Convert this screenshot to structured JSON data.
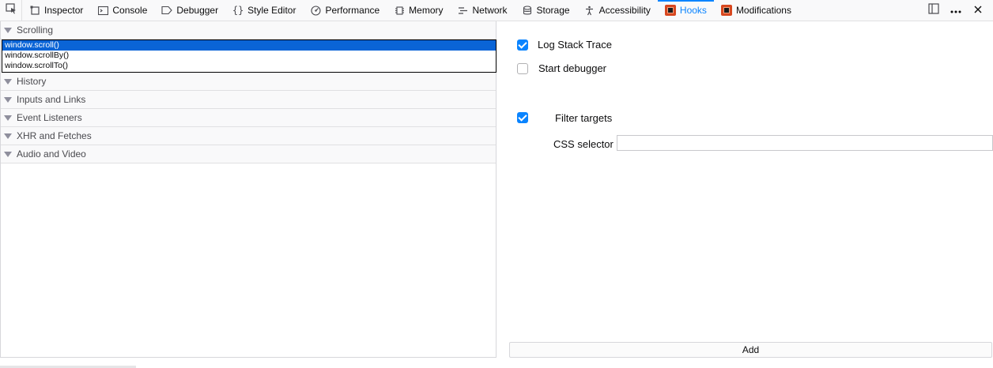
{
  "toolbar": {
    "tabs": [
      {
        "label": "Inspector",
        "icon": "inspector-icon"
      },
      {
        "label": "Console",
        "icon": "console-icon"
      },
      {
        "label": "Debugger",
        "icon": "debugger-icon"
      },
      {
        "label": "Style Editor",
        "icon": "braces-icon"
      },
      {
        "label": "Performance",
        "icon": "performance-icon"
      },
      {
        "label": "Memory",
        "icon": "memory-icon"
      },
      {
        "label": "Network",
        "icon": "network-icon"
      },
      {
        "label": "Storage",
        "icon": "storage-icon"
      },
      {
        "label": "Accessibility",
        "icon": "accessibility-icon"
      },
      {
        "label": "Hooks",
        "icon": "hooks-extension-icon",
        "selected": true
      },
      {
        "label": "Modifications",
        "icon": "modifications-extension-icon"
      }
    ],
    "accent": "#0a84ff"
  },
  "sections": [
    {
      "title": "Scrolling",
      "options": [
        "window.scroll()",
        "window.scrollBy()",
        "window.scrollTo()"
      ],
      "selected": "window.scroll()"
    },
    {
      "title": "History"
    },
    {
      "title": "Inputs and Links"
    },
    {
      "title": "Event Listeners"
    },
    {
      "title": "XHR and Fetches"
    },
    {
      "title": "Audio and Video"
    }
  ],
  "options": {
    "log_stack_trace": {
      "label": "Log Stack Trace",
      "checked": true
    },
    "start_debugger": {
      "label": "Start debugger",
      "checked": false
    },
    "filter_targets": {
      "label": "Filter targets",
      "checked": true
    },
    "css_selector": {
      "label": "CSS selector",
      "value": ""
    }
  },
  "add_button": "Add"
}
